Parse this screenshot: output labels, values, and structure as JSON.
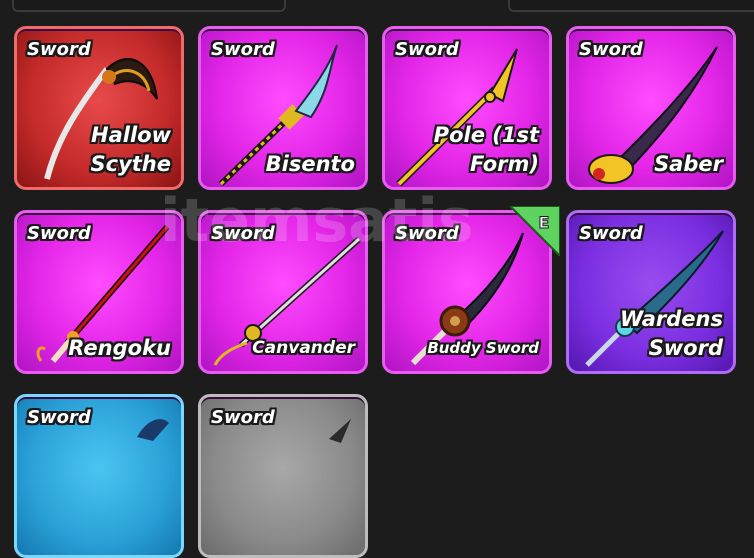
{
  "inventory": {
    "cards": [
      {
        "type": "Sword",
        "name_lines": [
          "Hallow",
          "Scythe"
        ],
        "rarity": "mythical"
      },
      {
        "type": "Sword",
        "name_lines": [
          "Bisento"
        ],
        "rarity": "epic"
      },
      {
        "type": "Sword",
        "name_lines": [
          "Pole (1st",
          "Form)"
        ],
        "rarity": "epic"
      },
      {
        "type": "Sword",
        "name_lines": [
          "Saber"
        ],
        "rarity": "epic"
      },
      {
        "type": "Sword",
        "name_lines": [
          "Rengoku"
        ],
        "rarity": "epic"
      },
      {
        "type": "Sword",
        "name_lines": [
          "Canvander"
        ],
        "rarity": "epic"
      },
      {
        "type": "Sword",
        "name_lines": [
          "Buddy Sword"
        ],
        "rarity": "epic",
        "equipped": true
      },
      {
        "type": "Sword",
        "name_lines": [
          "Wardens",
          "Sword"
        ],
        "rarity": "legendary"
      },
      {
        "type": "Sword",
        "name_lines": [],
        "rarity": "rare"
      },
      {
        "type": "Sword",
        "name_lines": [],
        "rarity": "common"
      }
    ],
    "equipped_badge": "E"
  },
  "colors": {
    "epic": "#e426e8",
    "mythical": "#c42a2a",
    "legendary": "#7a2ee0",
    "rare": "#2aa0d8",
    "common": "#8a8a8a",
    "equipped_badge": "#5fd35f"
  },
  "watermark": "itemsatis"
}
